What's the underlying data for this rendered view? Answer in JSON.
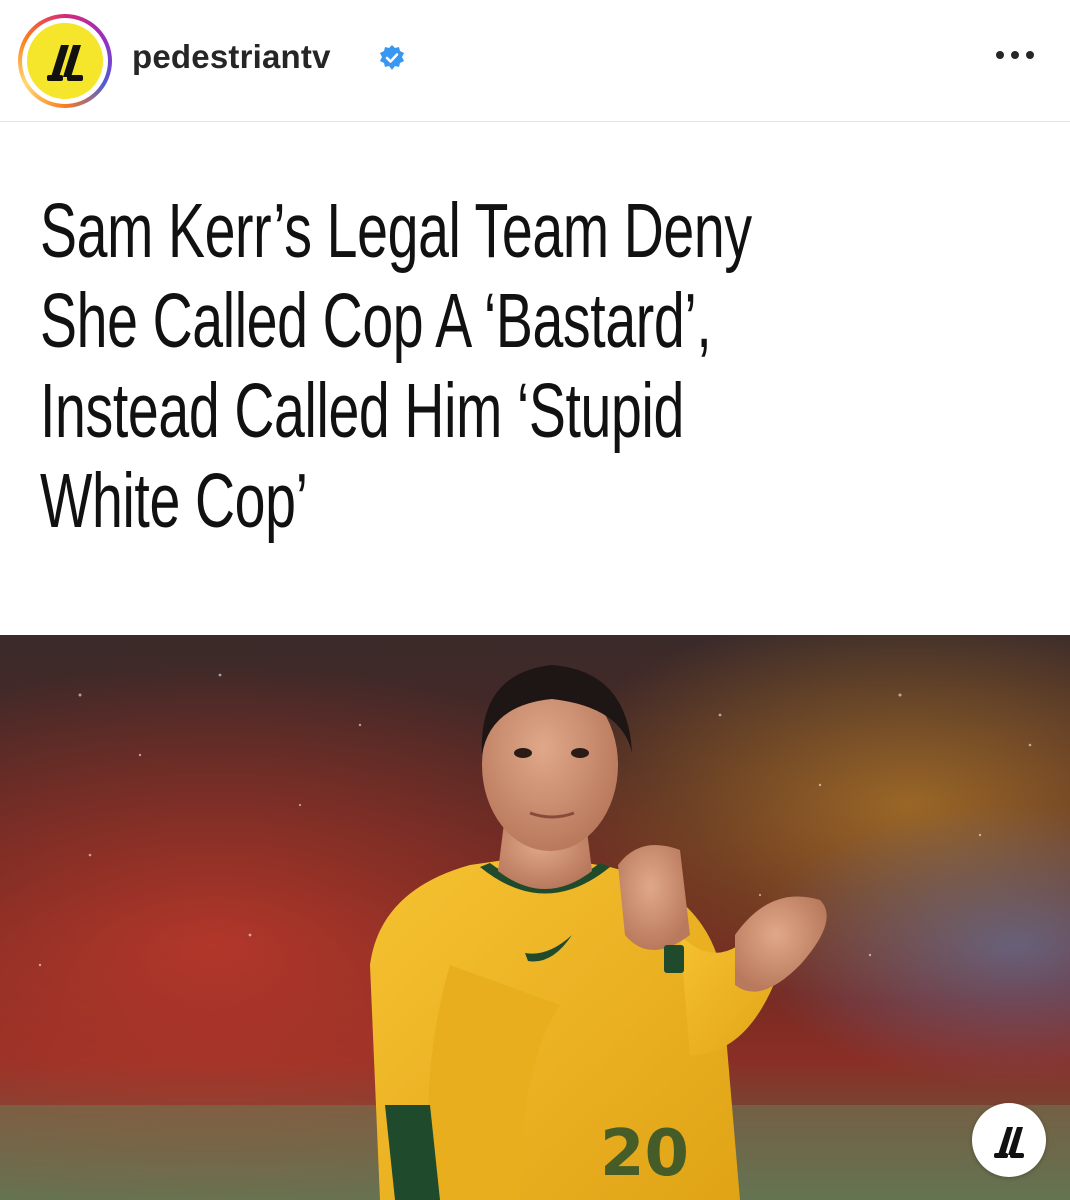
{
  "post": {
    "username": "pedestriantv",
    "verified": true,
    "more_icon": "more-horizontal-icon",
    "avatar_icon": "pedestrian-logo-icon"
  },
  "article": {
    "headline_lines": [
      "Sam Kerr’s Legal Team Deny",
      "She Called Cop A ‘Bastard’,",
      "Instead Called Him ‘Stupid",
      "White Cop’"
    ],
    "jersey_number": "20"
  },
  "colors": {
    "brand_yellow": "#f5e62b",
    "verified_blue": "#3897f0",
    "jersey_gold": "#f2b51d",
    "jersey_green": "#1f4a2c"
  }
}
